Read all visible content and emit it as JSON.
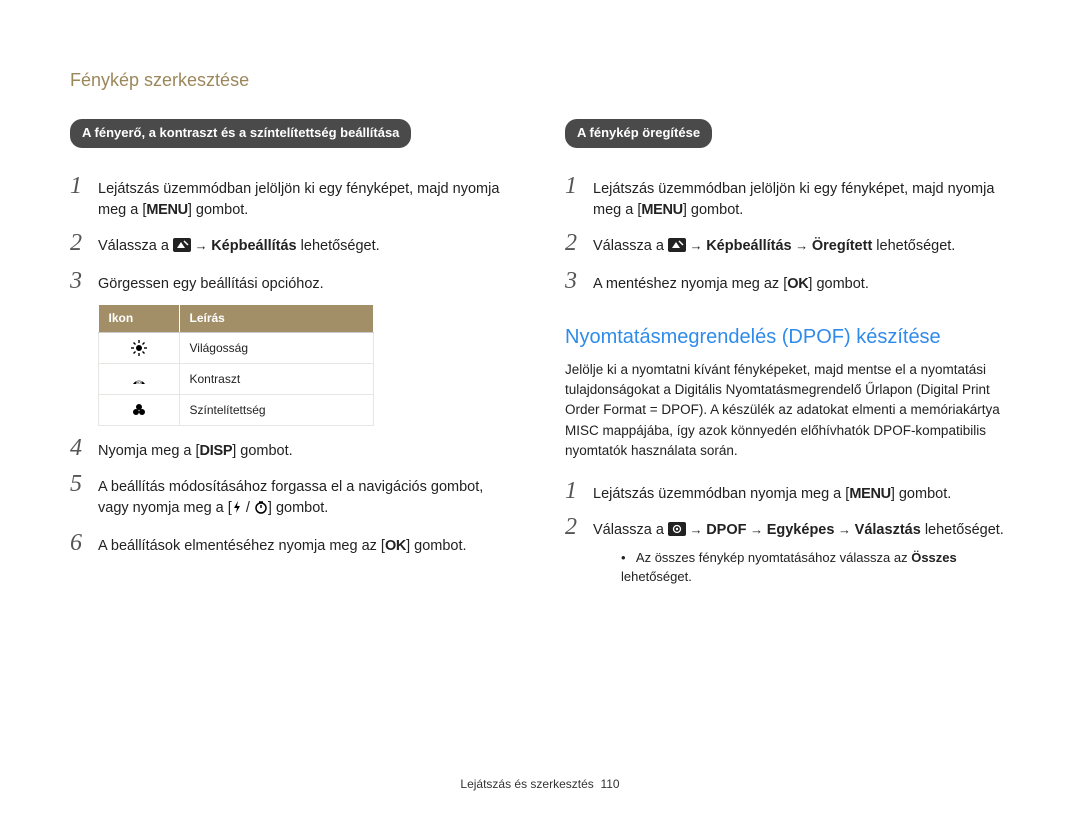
{
  "page": {
    "title": "Fénykép szerkesztése",
    "footer": "Lejátszás és szerkesztés",
    "page_number": "110"
  },
  "buttons": {
    "menu": "MENU",
    "disp": "DISP",
    "ok": "OK"
  },
  "left": {
    "header": "A fényerő, a kontraszt és a színtelítettség beállítása",
    "step1_a": "Lejátszás üzemmódban jelöljön ki egy fényképet, majd nyomja meg a [",
    "step1_b": "] gombot.",
    "step2_a": "Válassza a ",
    "step2_arrow": " → ",
    "step2_b": "Képbeállítás",
    "step2_c": " lehetőséget.",
    "step3": "Görgessen egy beállítási opcióhoz.",
    "table": {
      "head_icon": "Ikon",
      "head_desc": "Leírás",
      "rows": [
        {
          "icon": "brightness",
          "label": "Világosság"
        },
        {
          "icon": "contrast",
          "label": "Kontraszt"
        },
        {
          "icon": "saturation",
          "label": "Színtelítettség"
        }
      ]
    },
    "step4_a": "Nyomja meg a [",
    "step4_b": "] gombot.",
    "step5_a": "A beállítás módosításához forgassa el a navigációs gombot, vagy nyomja meg a [",
    "step5_b": "] gombot.",
    "step6_a": "A beállítások elmentéséhez nyomja meg az [",
    "step6_b": "] gombot."
  },
  "right": {
    "header": "A fénykép öregítése",
    "step1_a": "Lejátszás üzemmódban jelöljön ki egy fényképet, majd nyomja meg a [",
    "step1_b": "] gombot.",
    "step2_a": "Válassza a ",
    "step2_b": "Képbeállítás",
    "step2_c": "Öregített",
    "step2_d": " lehetőséget.",
    "step3_a": "A mentéshez nyomja meg az [",
    "step3_b": "] gombot.",
    "heading2": "Nyomtatásmegrendelés (DPOF) készítése",
    "paragraph": "Jelölje ki a nyomtatni kívánt fényképeket, majd mentse el a nyomtatási tulajdonságokat a Digitális Nyomtatásmegrendelő Űrlapon (Digital Print Order Format = DPOF). A készülék az adatokat elmenti a memóriakártya MISC mappájába, így azok könnyedén előhívhatók DPOF-kompatibilis nyomtatók használata során.",
    "d_step1_a": "Lejátszás üzemmódban nyomja meg a [",
    "d_step1_b": "] gombot.",
    "d_step2_a": "Válassza a ",
    "d_step2_b": "DPOF",
    "d_step2_c": "Egyképes",
    "d_step2_d": "Választás",
    "d_step2_e": "lehetőséget.",
    "note_a": "Az összes fénykép nyomtatásához válassza az ",
    "note_b": "Összes",
    "note_c": " lehetőséget."
  }
}
